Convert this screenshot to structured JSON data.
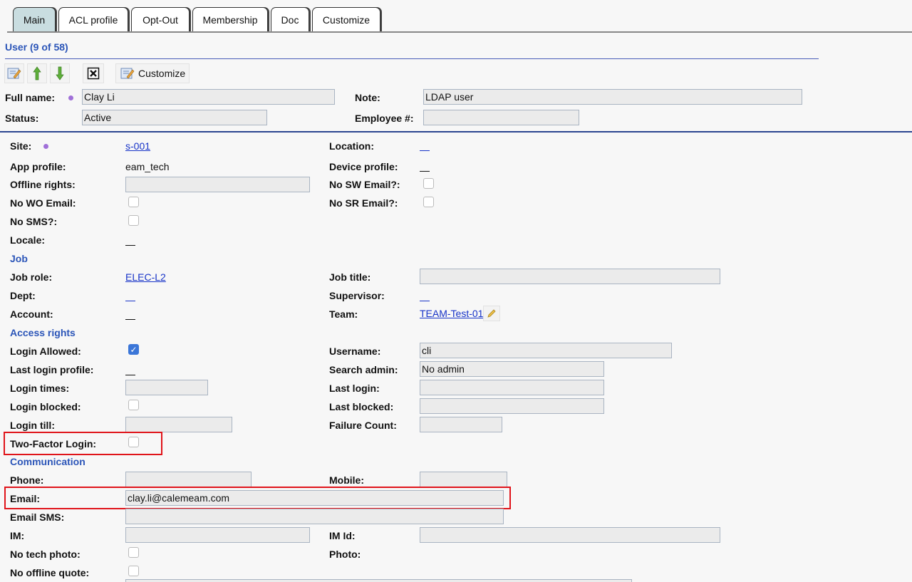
{
  "tabs": [
    {
      "label": "Main",
      "active": true
    },
    {
      "label": "ACL profile",
      "active": false
    },
    {
      "label": "Opt-Out",
      "active": false
    },
    {
      "label": "Membership",
      "active": false
    },
    {
      "label": "Doc",
      "active": false
    },
    {
      "label": "Customize",
      "active": false
    }
  ],
  "header": {
    "title": "User (9 of 58)",
    "toolbar": {
      "customize_label": "Customize"
    },
    "full_name_label": "Full name:",
    "full_name_value": "Clay Li",
    "note_label": "Note:",
    "note_value": "LDAP user",
    "status_label": "Status:",
    "status_value": "Active",
    "employee_label": "Employee #:",
    "employee_value": ""
  },
  "general": {
    "site_label": "Site:",
    "site_value": "s-001",
    "location_label": "Location:",
    "app_profile_label": "App profile:",
    "app_profile_value": "eam_tech",
    "device_profile_label": "Device profile:",
    "offline_rights_label": "Offline rights:",
    "no_sw_email_label": "No SW Email?:",
    "no_wo_email_label": "No WO Email:",
    "no_sr_email_label": "No SR Email?:",
    "no_sms_label": "No SMS?:",
    "locale_label": "Locale:"
  },
  "job": {
    "heading": "Job",
    "job_role_label": "Job role:",
    "job_role_value": "ELEC-L2",
    "job_title_label": "Job title:",
    "job_title_value": "",
    "dept_label": "Dept:",
    "supervisor_label": "Supervisor:",
    "account_label": "Account:",
    "team_label": "Team:",
    "team_value": "TEAM-Test-01"
  },
  "access": {
    "heading": "Access rights",
    "login_allowed_label": "Login Allowed:",
    "login_allowed_checked": true,
    "username_label": "Username:",
    "username_value": "cli",
    "last_login_profile_label": "Last login profile:",
    "search_admin_label": "Search admin:",
    "search_admin_value": "No admin",
    "login_times_label": "Login times:",
    "last_login_label": "Last login:",
    "login_blocked_label": "Login blocked:",
    "last_blocked_label": "Last blocked:",
    "login_till_label": "Login till:",
    "failure_count_label": "Failure Count:",
    "two_factor_label": "Two-Factor Login:"
  },
  "communication": {
    "heading": "Communication",
    "phone_label": "Phone:",
    "mobile_label": "Mobile:",
    "email_label": "Email:",
    "email_value": "clay.li@calemeam.com",
    "email_sms_label": "Email SMS:",
    "im_label": "IM:",
    "im_id_label": "IM Id:",
    "no_tech_photo_label": "No tech photo:",
    "photo_label": "Photo:",
    "no_offline_quote_label": "No offline quote:"
  },
  "colors": {
    "accent": "#2b55b8",
    "link": "#1733c8",
    "active_tab": "#c9dde0",
    "highlight": "#e0141a"
  }
}
